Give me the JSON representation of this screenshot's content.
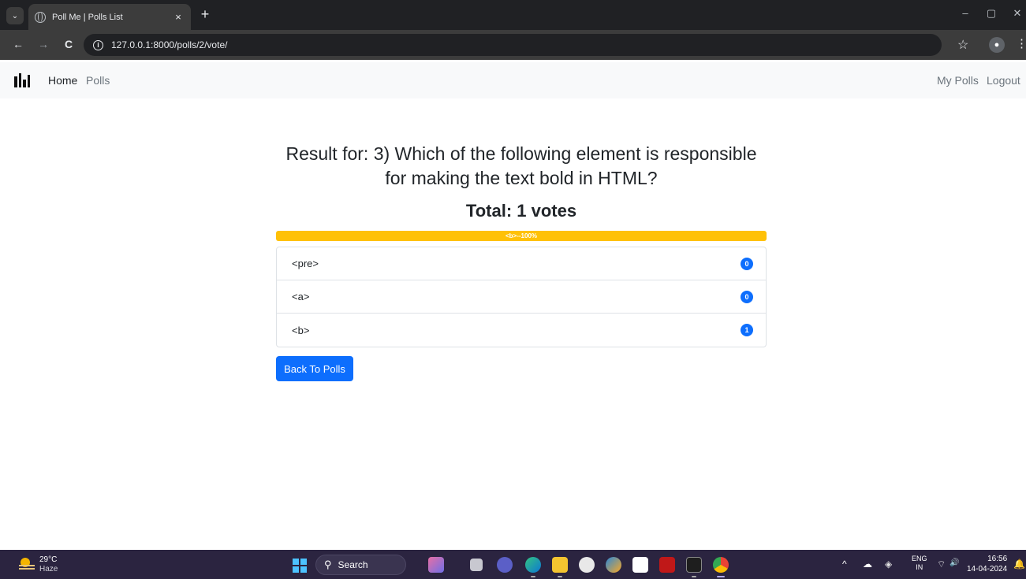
{
  "browser": {
    "tab_menu_glyph": "⌄",
    "tab_title": "Poll Me | Polls List",
    "tab_close": "×",
    "new_tab": "+",
    "minimize": "–",
    "restore": "▢",
    "close": "✕",
    "back": "←",
    "forward": "→",
    "reload": "C",
    "url": "127.0.0.1:8000/polls/2/vote/",
    "star": "☆",
    "kebab": "⋮"
  },
  "navbar": {
    "home": "Home",
    "polls": "Polls",
    "my_polls": "My Polls",
    "logout": "Logout"
  },
  "result": {
    "title": "Result for: 3) Which of the following element is responsible for making the text bold in HTML?",
    "total": "Total: 1 votes",
    "progress_label": "<b>--100%",
    "progress_fraction": 1.0,
    "choices": [
      {
        "label": "<pre>",
        "votes": "0"
      },
      {
        "label": "<a>",
        "votes": "0"
      },
      {
        "label": "<b>",
        "votes": "1"
      }
    ],
    "back_button": "Back To Polls"
  },
  "colors": {
    "progress": "#ffc107",
    "primary": "#0d6efd"
  },
  "taskbar": {
    "weather_temp": "29°C",
    "weather_desc": "Haze",
    "search_glyph": "⚲",
    "search": "Search",
    "tray_up": "^",
    "lang_top": "ENG",
    "lang_bottom": "IN",
    "wifi": "⌔",
    "volume": "🔊",
    "time": "16:56",
    "date": "14-04-2024"
  }
}
